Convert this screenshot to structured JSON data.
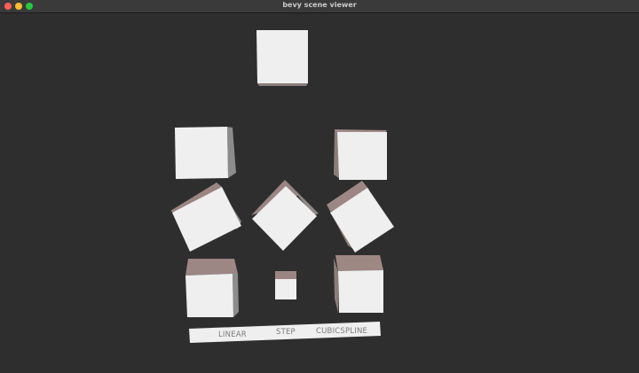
{
  "window": {
    "title": "bevy scene viewer",
    "controls": [
      "close",
      "minimize",
      "maximize"
    ]
  },
  "colors": {
    "background": "#2e2e2e",
    "cube_face": "#efefef",
    "cube_side": "#8c7d7a",
    "cube_top": "#9d8683",
    "label_panel": "#efefef",
    "label_text": "#7b7b7b"
  },
  "scene": {
    "cubes": [
      {
        "name": "cube-top-center"
      },
      {
        "name": "cube-row1-left"
      },
      {
        "name": "cube-row1-right"
      },
      {
        "name": "cube-row2-left"
      },
      {
        "name": "cube-row2-center"
      },
      {
        "name": "cube-row2-right"
      },
      {
        "name": "cube-row3-left"
      },
      {
        "name": "cube-row3-center"
      },
      {
        "name": "cube-row3-right"
      }
    ],
    "labels": {
      "linear": "LINEAR",
      "step": "STEP",
      "cubicspline": "CUBICSPLINE"
    }
  }
}
